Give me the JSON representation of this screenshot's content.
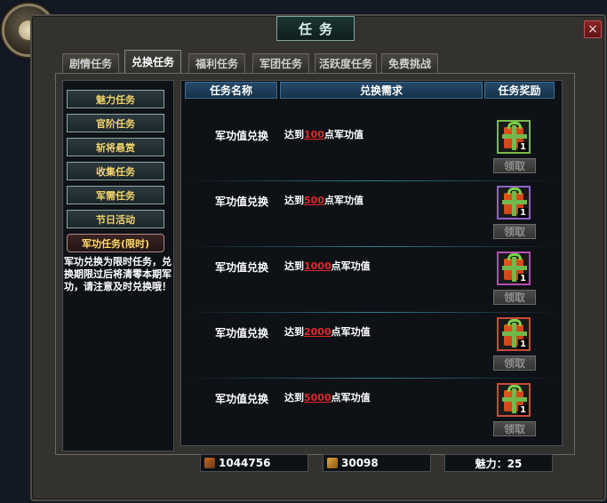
{
  "window": {
    "title": "任务",
    "close_label": "×"
  },
  "tabs": [
    {
      "label": "剧情任务",
      "active": false
    },
    {
      "label": "兑换任务",
      "active": true
    },
    {
      "label": "福利任务",
      "active": false
    },
    {
      "label": "军团任务",
      "active": false
    },
    {
      "label": "活跃度任务",
      "active": false
    },
    {
      "label": "免费挑战",
      "active": false
    }
  ],
  "sidebar": {
    "items": [
      {
        "label": "魅力任务"
      },
      {
        "label": "官阶任务"
      },
      {
        "label": "斩将悬赏"
      },
      {
        "label": "收集任务"
      },
      {
        "label": "军需任务"
      },
      {
        "label": "节日活动"
      },
      {
        "label": "军功任务(限时)",
        "active": true
      }
    ],
    "description": "军功兑换为限时任务，兑换期限过后将清零本期军功，请注意及时兑换哦！"
  },
  "table": {
    "headers": {
      "name": "任务名称",
      "requirement": "兑换需求",
      "reward": "任务奖励"
    },
    "rows": [
      {
        "name": "军功值兑换",
        "req_prefix": "达到",
        "req_value": "100",
        "req_suffix": "点军功值",
        "reward_qty": "1",
        "claim_label": "领取",
        "frame_color": "#7ab94a"
      },
      {
        "name": "军功值兑换",
        "req_prefix": "达到",
        "req_value": "500",
        "req_suffix": "点军功值",
        "reward_qty": "1",
        "claim_label": "领取",
        "frame_color": "#8c63c9"
      },
      {
        "name": "军功值兑换",
        "req_prefix": "达到",
        "req_value": "1000",
        "req_suffix": "点军功值",
        "reward_qty": "1",
        "claim_label": "领取",
        "frame_color": "#b24fb0"
      },
      {
        "name": "军功值兑换",
        "req_prefix": "达到",
        "req_value": "2000",
        "req_suffix": "点军功值",
        "reward_qty": "1",
        "claim_label": "领取",
        "frame_color": "#c94a3a"
      },
      {
        "name": "军功值兑换",
        "req_prefix": "达到",
        "req_value": "5000",
        "req_suffix": "点军功值",
        "reward_qty": "1",
        "claim_label": "领取",
        "frame_color": "#c94a3a"
      }
    ]
  },
  "footer": {
    "stat1": "1044756",
    "stat2": "30098",
    "charm": "魅力：25"
  },
  "colors": {
    "accent_gold": "#f2d36a",
    "highlight_red": "#e0282a",
    "header_blue": "#254a6b"
  }
}
